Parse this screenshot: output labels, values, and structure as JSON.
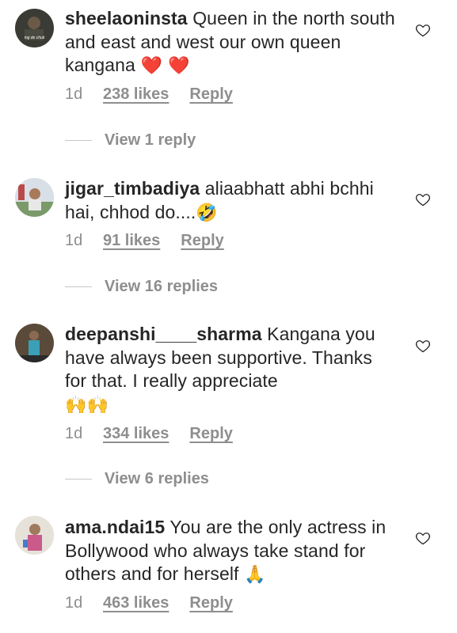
{
  "comments": [
    {
      "username": "sheelaoninsta",
      "text": "Queen in the north south and east and west our own queen kangana",
      "emoji": "❤️ ❤️",
      "time": "1d",
      "likes": "238 likes",
      "reply": "Reply",
      "avatar_text": "ing de chuti",
      "view_replies": "View 1 reply"
    },
    {
      "username": "jigar_timbadiya",
      "text": "aliaabhatt abhi bchhi hai, chhod do....",
      "emoji": "🤣",
      "time": "1d",
      "likes": "91 likes",
      "reply": "Reply",
      "view_replies": "View 16 replies"
    },
    {
      "username": "deepanshi____sharma",
      "text": "Kangana you have always been supportive. Thanks for that. I really appreciate",
      "emoji": "🙌🙌",
      "time": "1d",
      "likes": "334 likes",
      "reply": "Reply",
      "view_replies": "View 6 replies"
    },
    {
      "username": "ama.ndai15",
      "text": "You are the only actress in Bollywood who always take stand for others and for herself",
      "emoji": "🙏",
      "time": "1d",
      "likes": "463 likes",
      "reply": "Reply"
    }
  ],
  "colors": {
    "text": "#262626",
    "secondary": "#8e8e8e",
    "heart_red": "#e0245e"
  }
}
